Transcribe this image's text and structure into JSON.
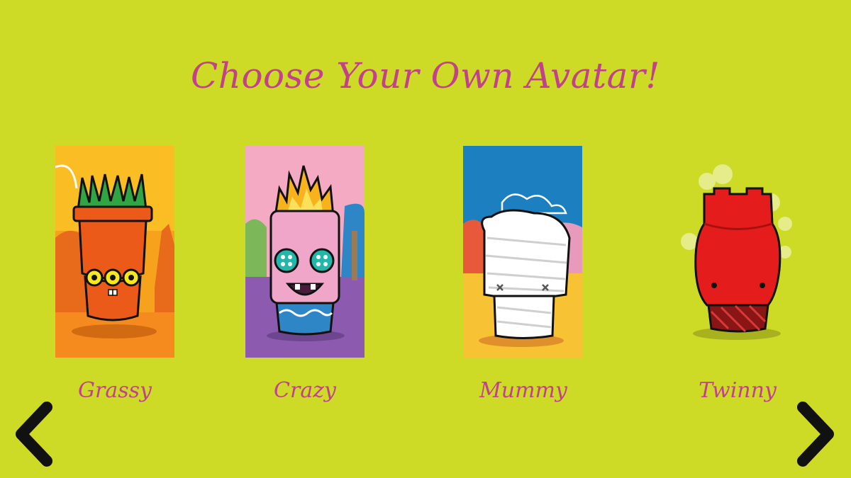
{
  "page": {
    "title": "Choose Your Own Avatar!"
  },
  "colors": {
    "background": "#cddb27",
    "accent": "#c2428a"
  },
  "avatars": [
    {
      "label": "Grassy"
    },
    {
      "label": "Crazy"
    },
    {
      "label": "Mummy"
    },
    {
      "label": "Twinny"
    }
  ],
  "navigation": {
    "prev_icon": "chevron-left-icon",
    "next_icon": "chevron-right-icon"
  }
}
